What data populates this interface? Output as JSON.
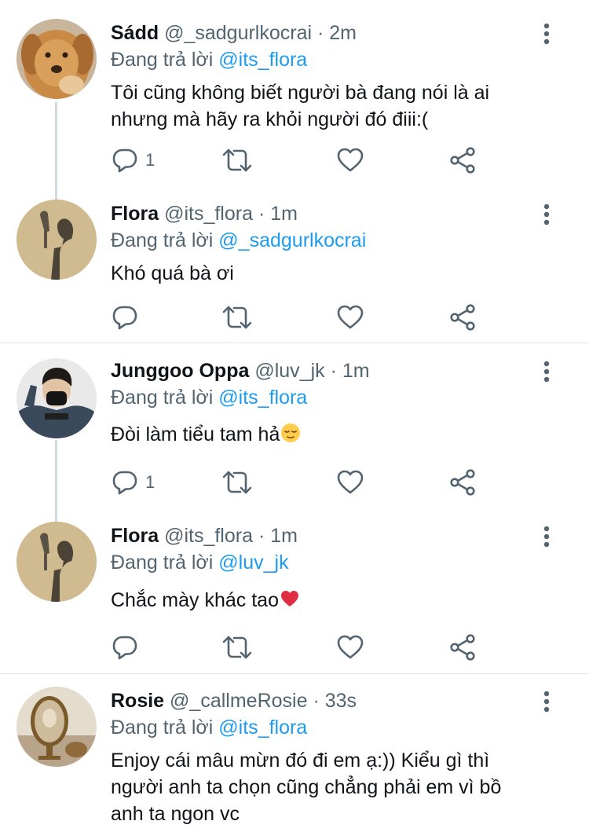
{
  "colors": {
    "text": "#0f1419",
    "secondary": "#536471",
    "link": "#1d9bf0",
    "divider": "#e1e6ea",
    "thread_line": "#cfd9de"
  },
  "icons": {
    "more": "more-vertical-icon",
    "reply": "reply-icon",
    "retweet": "retweet-icon",
    "like": "heart-icon",
    "share": "share-icon"
  },
  "tweets": [
    {
      "name": "Sádd",
      "handle": "@_sadgurlkocrai",
      "dot": "·",
      "time": "2m",
      "reply_prefix": "Đang trả lời",
      "reply_to": "@its_flora",
      "lines": [
        "Tôi cũng không biết người bà đang nói là ai",
        "nhưng mà hãy ra khỏi người đó điii:("
      ],
      "reply_count": "1"
    },
    {
      "name": "Flora",
      "handle": "@its_flora",
      "dot": "·",
      "time": "1m",
      "reply_prefix": "Đang trả lời",
      "reply_to": "@_sadgurlkocrai",
      "lines": [
        "Khó quá bà ơi"
      ],
      "reply_count": ""
    },
    {
      "name": "Junggoo Oppa",
      "handle": "@luv_jk",
      "dot": "·",
      "time": "1m",
      "reply_prefix": "Đang trả lời",
      "reply_to": "@its_flora",
      "lines": [
        "Đòi làm tiểu tam hả"
      ],
      "emoji": "relieved-face-emoji",
      "reply_count": "1"
    },
    {
      "name": "Flora",
      "handle": "@its_flora",
      "dot": "·",
      "time": "1m",
      "reply_prefix": "Đang trả lời",
      "reply_to": "@luv_jk",
      "lines": [
        "Chắc mày khác tao"
      ],
      "emoji": "red-heart-emoji",
      "reply_count": ""
    },
    {
      "name": "Rosie",
      "handle": "@_callmeRosie",
      "dot": "·",
      "time": "33s",
      "reply_prefix": "Đang trả lời",
      "reply_to": "@its_flora",
      "lines": [
        "Enjoy cái mâu mừn đó đi em ạ:)) Kiểu gì thì",
        "người anh ta chọn cũng chẳng phải em vì bồ",
        "anh ta ngon vc"
      ],
      "reply_count": ""
    }
  ]
}
